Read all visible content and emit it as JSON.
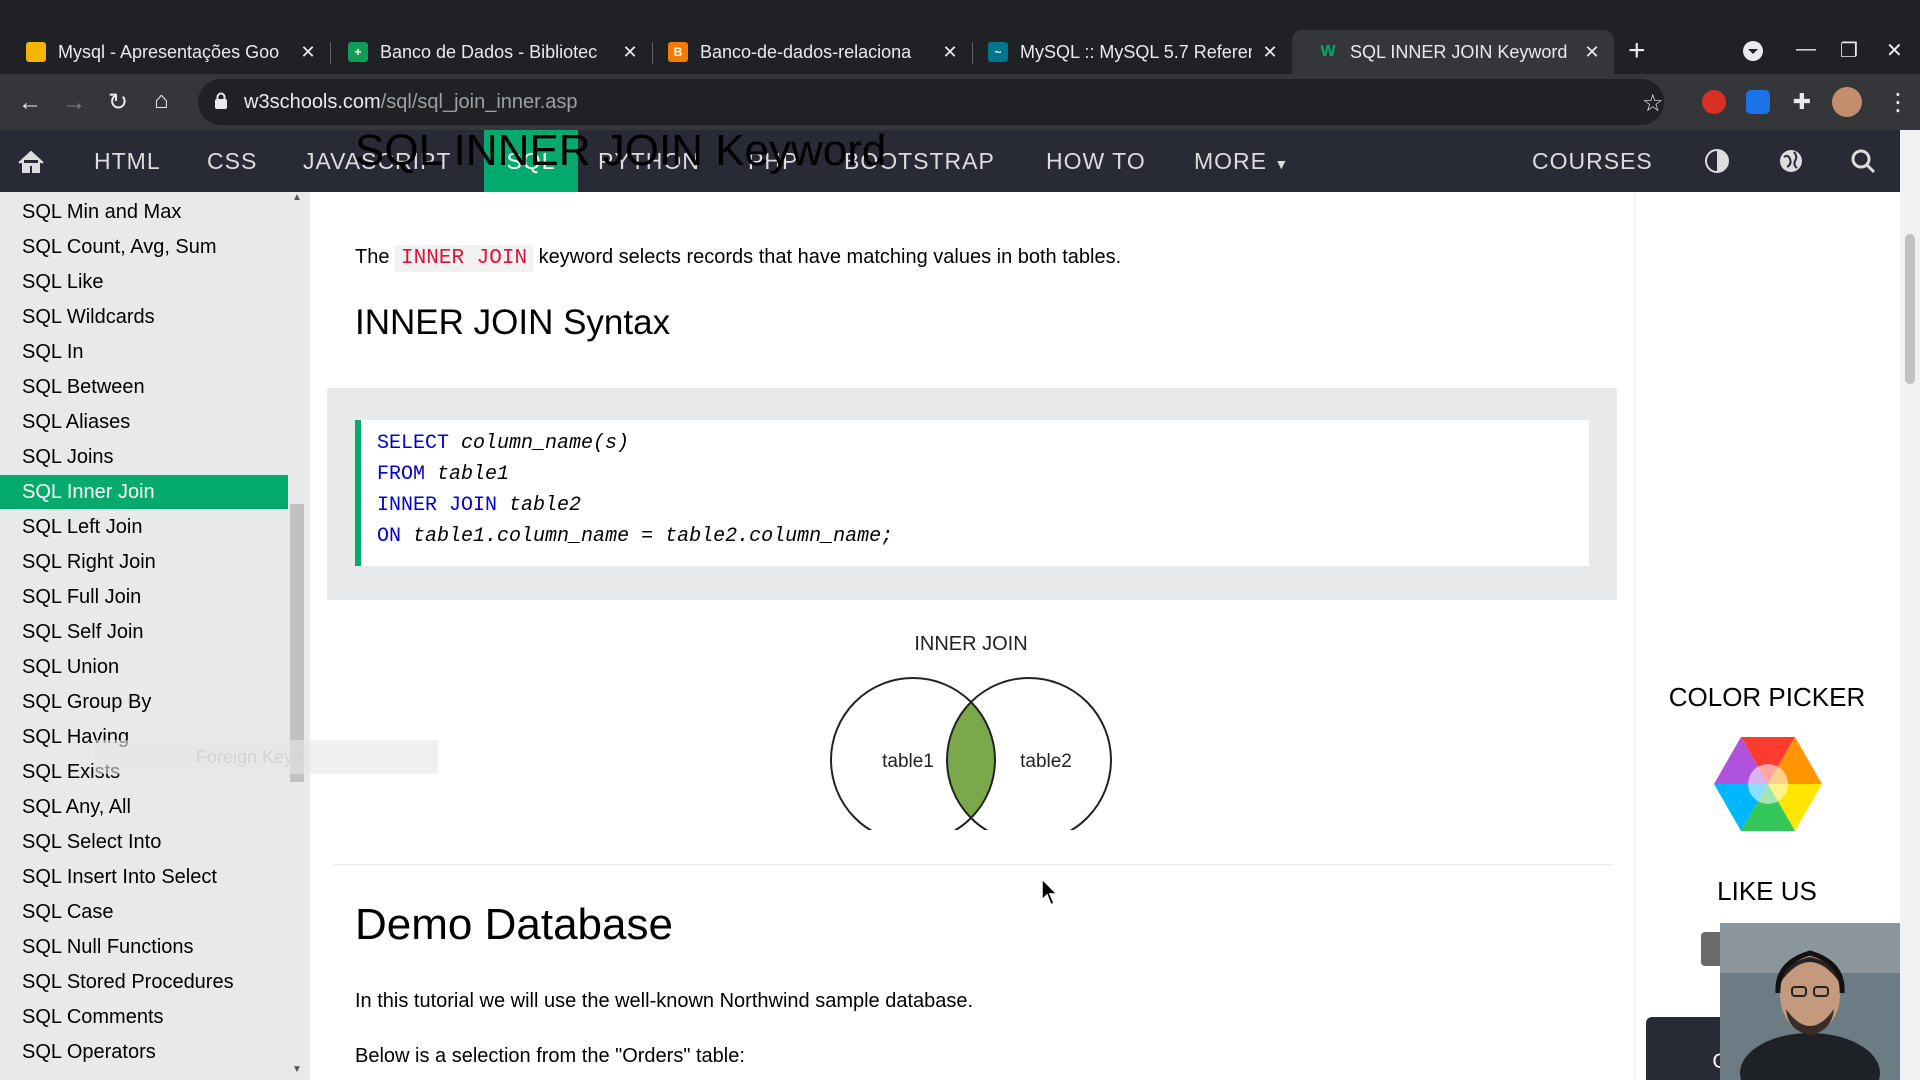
{
  "browser": {
    "tabs": [
      {
        "title": "Mysql - Apresentações Goo",
        "favicon_color": "#f4b400",
        "active": false
      },
      {
        "title": "Banco de Dados - Bibliotec",
        "favicon_color": "#0f9d58",
        "active": false
      },
      {
        "title": "Banco-de-dados-relaciona",
        "favicon_color": "#f57c00",
        "active": false
      },
      {
        "title": "MySQL :: MySQL 5.7 Referenc",
        "favicon_color": "#00758f",
        "active": false
      },
      {
        "title": "SQL INNER JOIN Keyword",
        "favicon_color": "#04aa6d",
        "active": true
      }
    ],
    "url_host": "w3schools.com",
    "url_path": "/sql/sql_join_inner.asp"
  },
  "w3nav": {
    "items": [
      "HTML",
      "CSS",
      "JAVASCRIPT",
      "SQL",
      "PYTHON",
      "PHP",
      "BOOTSTRAP",
      "HOW TO",
      "MORE"
    ],
    "active": "SQL",
    "courses": "COURSES"
  },
  "sidebar": {
    "items": [
      "SQL Min and Max",
      "SQL Count, Avg, Sum",
      "SQL Like",
      "SQL Wildcards",
      "SQL In",
      "SQL Between",
      "SQL Aliases",
      "SQL Joins",
      "SQL Inner Join",
      "SQL Left Join",
      "SQL Right Join",
      "SQL Full Join",
      "SQL Self Join",
      "SQL Union",
      "SQL Group By",
      "SQL Having",
      "SQL Exists",
      "SQL Any, All",
      "SQL Select Into",
      "SQL Insert Into Select",
      "SQL Case",
      "SQL Null Functions",
      "SQL Stored Procedures",
      "SQL Comments",
      "SQL Operators"
    ],
    "active_index": 8,
    "drag_ghost": "Foreign Keys"
  },
  "main": {
    "title": "SQL INNER JOIN Keyword",
    "intro_pre": "The",
    "intro_kw": "INNER JOIN",
    "intro_post": "keyword selects records that have matching values in both tables.",
    "syntax_heading": "INNER JOIN Syntax",
    "code": [
      {
        "kw": "SELECT",
        "rest": "column_name(s)"
      },
      {
        "kw": "FROM",
        "rest": "table1"
      },
      {
        "kw": "INNER JOIN",
        "rest": "table2"
      },
      {
        "kw": "ON",
        "rest": "table1.column_name = table2.column_name;"
      }
    ],
    "venn": {
      "title": "INNER JOIN",
      "left": "table1",
      "right": "table2",
      "overlap_color": "#7aa84a"
    },
    "demo_heading": "Demo Database",
    "demo_text": "In this tutorial we will use the well-known Northwind sample database.",
    "orders_text": "Below is a selection from the \"Orders\" table:"
  },
  "right": {
    "color_picker": "COLOR PICKER",
    "like_us": "LIKE US",
    "get_certified": "Get certified"
  }
}
